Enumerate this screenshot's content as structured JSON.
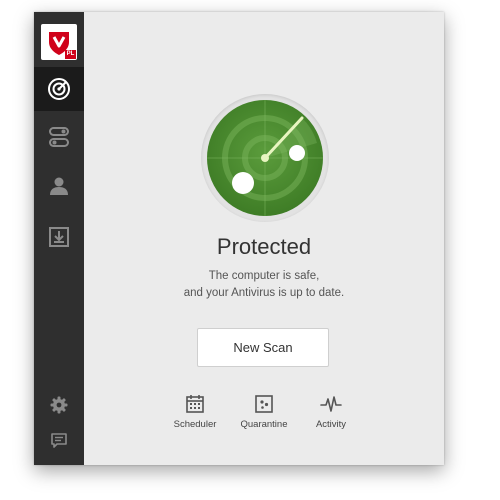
{
  "app": {
    "logo_badge": "PL",
    "colors": {
      "brand_red": "#d0021b",
      "radar_green": "#4a8a2e",
      "sidebar_bg": "#2f2f2f"
    }
  },
  "sidebar": {
    "items": [
      {
        "icon": "radar-icon",
        "active": true
      },
      {
        "icon": "toggle-icon",
        "active": false
      },
      {
        "icon": "user-icon",
        "active": false
      },
      {
        "icon": "download-icon",
        "active": false
      }
    ],
    "bottom": [
      {
        "icon": "gear-icon"
      },
      {
        "icon": "feedback-icon"
      }
    ]
  },
  "status": {
    "title": "Protected",
    "line1": "The computer is safe,",
    "line2": "and your Antivirus is up to date."
  },
  "actions": {
    "new_scan": "New Scan"
  },
  "tools": [
    {
      "label": "Scheduler",
      "icon": "calendar-icon"
    },
    {
      "label": "Quarantine",
      "icon": "quarantine-icon"
    },
    {
      "label": "Activity",
      "icon": "activity-icon"
    }
  ]
}
